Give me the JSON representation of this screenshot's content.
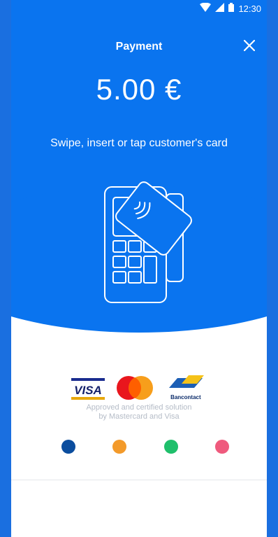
{
  "status_bar": {
    "time": "12:30",
    "icons": [
      "wifi-icon",
      "signal-icon",
      "battery-icon"
    ]
  },
  "header": {
    "title": "Payment",
    "close_icon": "close-icon"
  },
  "payment": {
    "amount": "5.00 €",
    "instruction": "Swipe, insert or tap customer's card",
    "illustration": "card-terminal-icon"
  },
  "brands": {
    "visa": "VISA",
    "mastercard": "mastercard-logo",
    "bancontact": "Bancontact",
    "approved_text": [
      "Approved and certified solution",
      "by Mastercard and Visa"
    ]
  },
  "page_indicator": {
    "dots": [
      {
        "color": "#0b4d9e"
      },
      {
        "color": "#f39a2a"
      },
      {
        "color": "#1fbf6b"
      },
      {
        "color": "#ef5a7d"
      }
    ]
  },
  "colors": {
    "primary": "#0a74ef",
    "background": "#ffffff"
  }
}
